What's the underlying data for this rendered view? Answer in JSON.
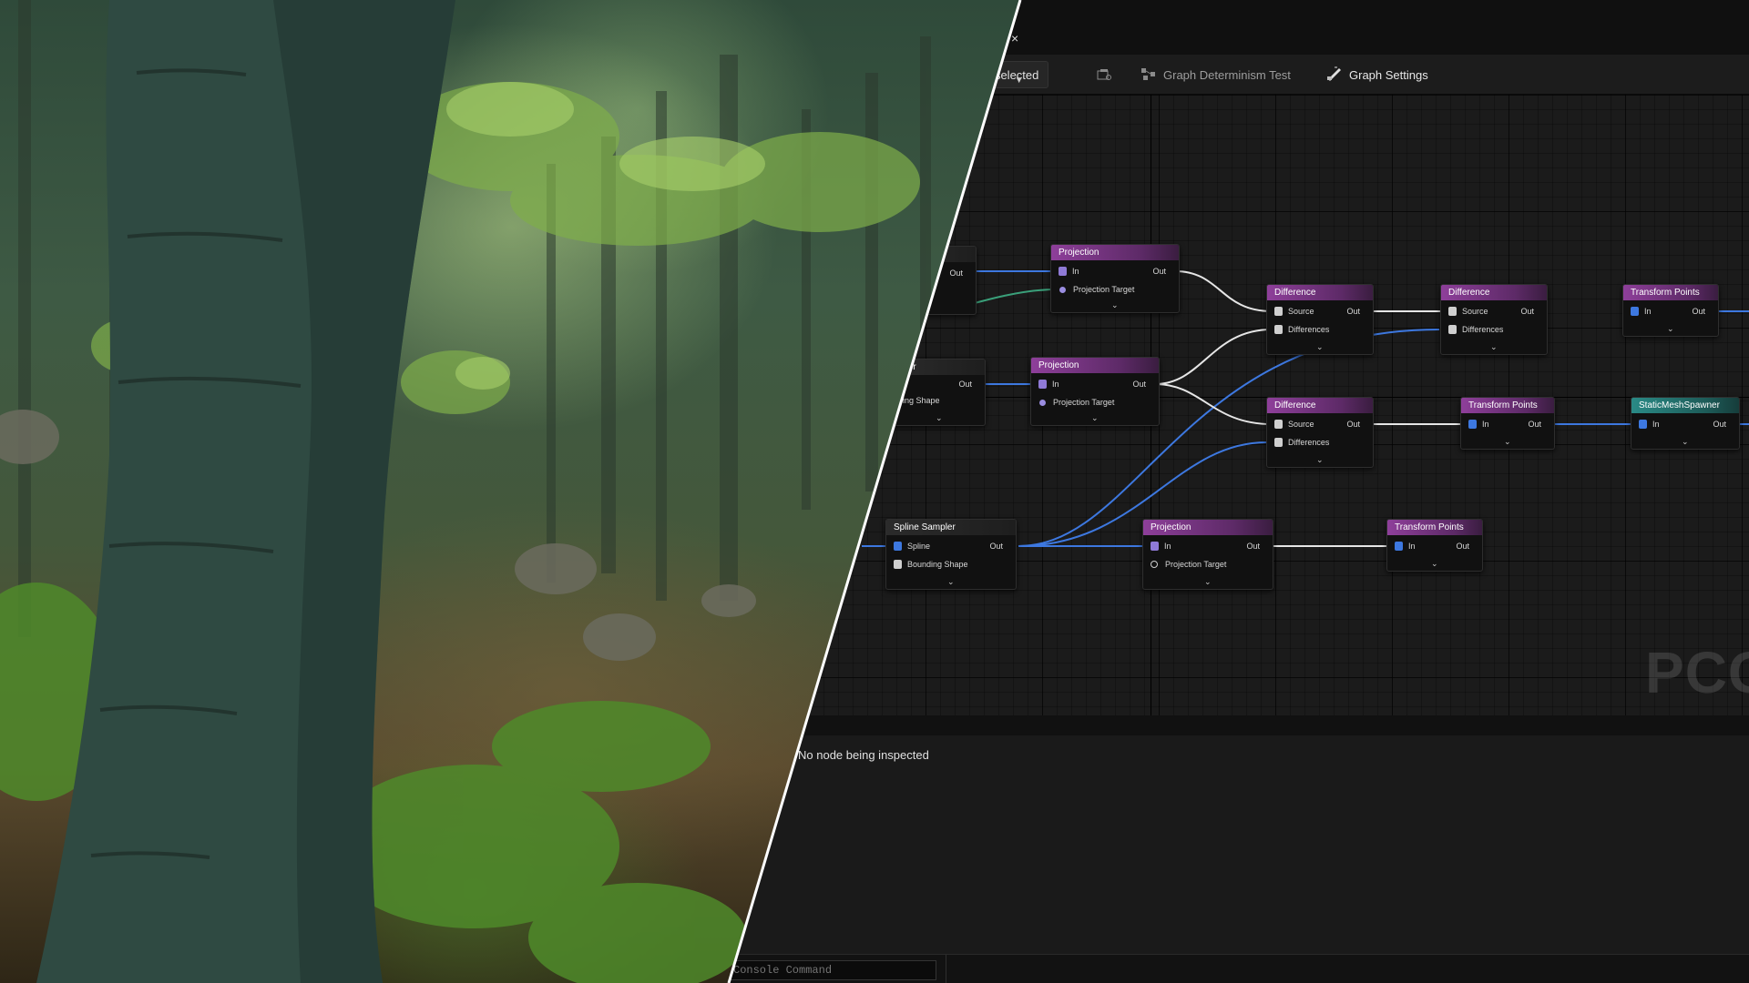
{
  "toolbar": {
    "debug_object": "ect selected",
    "determinism_test": "Graph Determinism Test",
    "graph_settings": "Graph Settings"
  },
  "tab": {
    "close": "×"
  },
  "nodes": {
    "n0": {
      "out": "Out"
    },
    "n1": {
      "title": "pler",
      "out": "Out",
      "pin": "ing Shape"
    },
    "p1": {
      "title": "Projection",
      "in": "In",
      "out": "Out",
      "target": "Projection Target"
    },
    "p2": {
      "title": "Projection",
      "in": "In",
      "out": "Out",
      "target": "Projection Target"
    },
    "d1": {
      "title": "Difference",
      "source": "Source",
      "out": "Out",
      "diff": "Differences"
    },
    "d2": {
      "title": "Difference",
      "source": "Source",
      "out": "Out",
      "diff": "Differences"
    },
    "d3": {
      "title": "Difference",
      "source": "Source",
      "out": "Out",
      "diff": "Differences"
    },
    "t1": {
      "title": "Transform Points",
      "in": "In",
      "out": "Out"
    },
    "t2": {
      "title": "Transform Points",
      "in": "In",
      "out": "Out"
    },
    "t3": {
      "title": "Transform Points",
      "in": "In",
      "out": "Out"
    },
    "sms": {
      "title": "StaticMeshSpawner",
      "in": "In",
      "out": "Out"
    },
    "ss": {
      "title": "Spline Sampler",
      "spline": "Spline",
      "out": "Out",
      "shape": "Bounding Shape"
    },
    "p3": {
      "title": "Projection",
      "in": "In",
      "out": "Out",
      "target": "Projection Target"
    }
  },
  "watermark": "PCG",
  "inspector": {
    "message": "No node being inspected"
  },
  "console": {
    "placeholder": "Console Command"
  },
  "colors": {
    "node_header_purple": "#8e3f9a",
    "node_header_teal": "#2a8a86",
    "wire_blue": "#3d78e0",
    "wire_white": "#e6e6e6",
    "wire_green": "#3aa07a",
    "debug_cyan": "#19e0e0"
  },
  "icons": {
    "tab_close": "close-icon",
    "dropdown": "chevron-down-icon",
    "browse": "browse-icon",
    "determinism": "determinism-icon",
    "settings": "graph-settings-icon"
  }
}
